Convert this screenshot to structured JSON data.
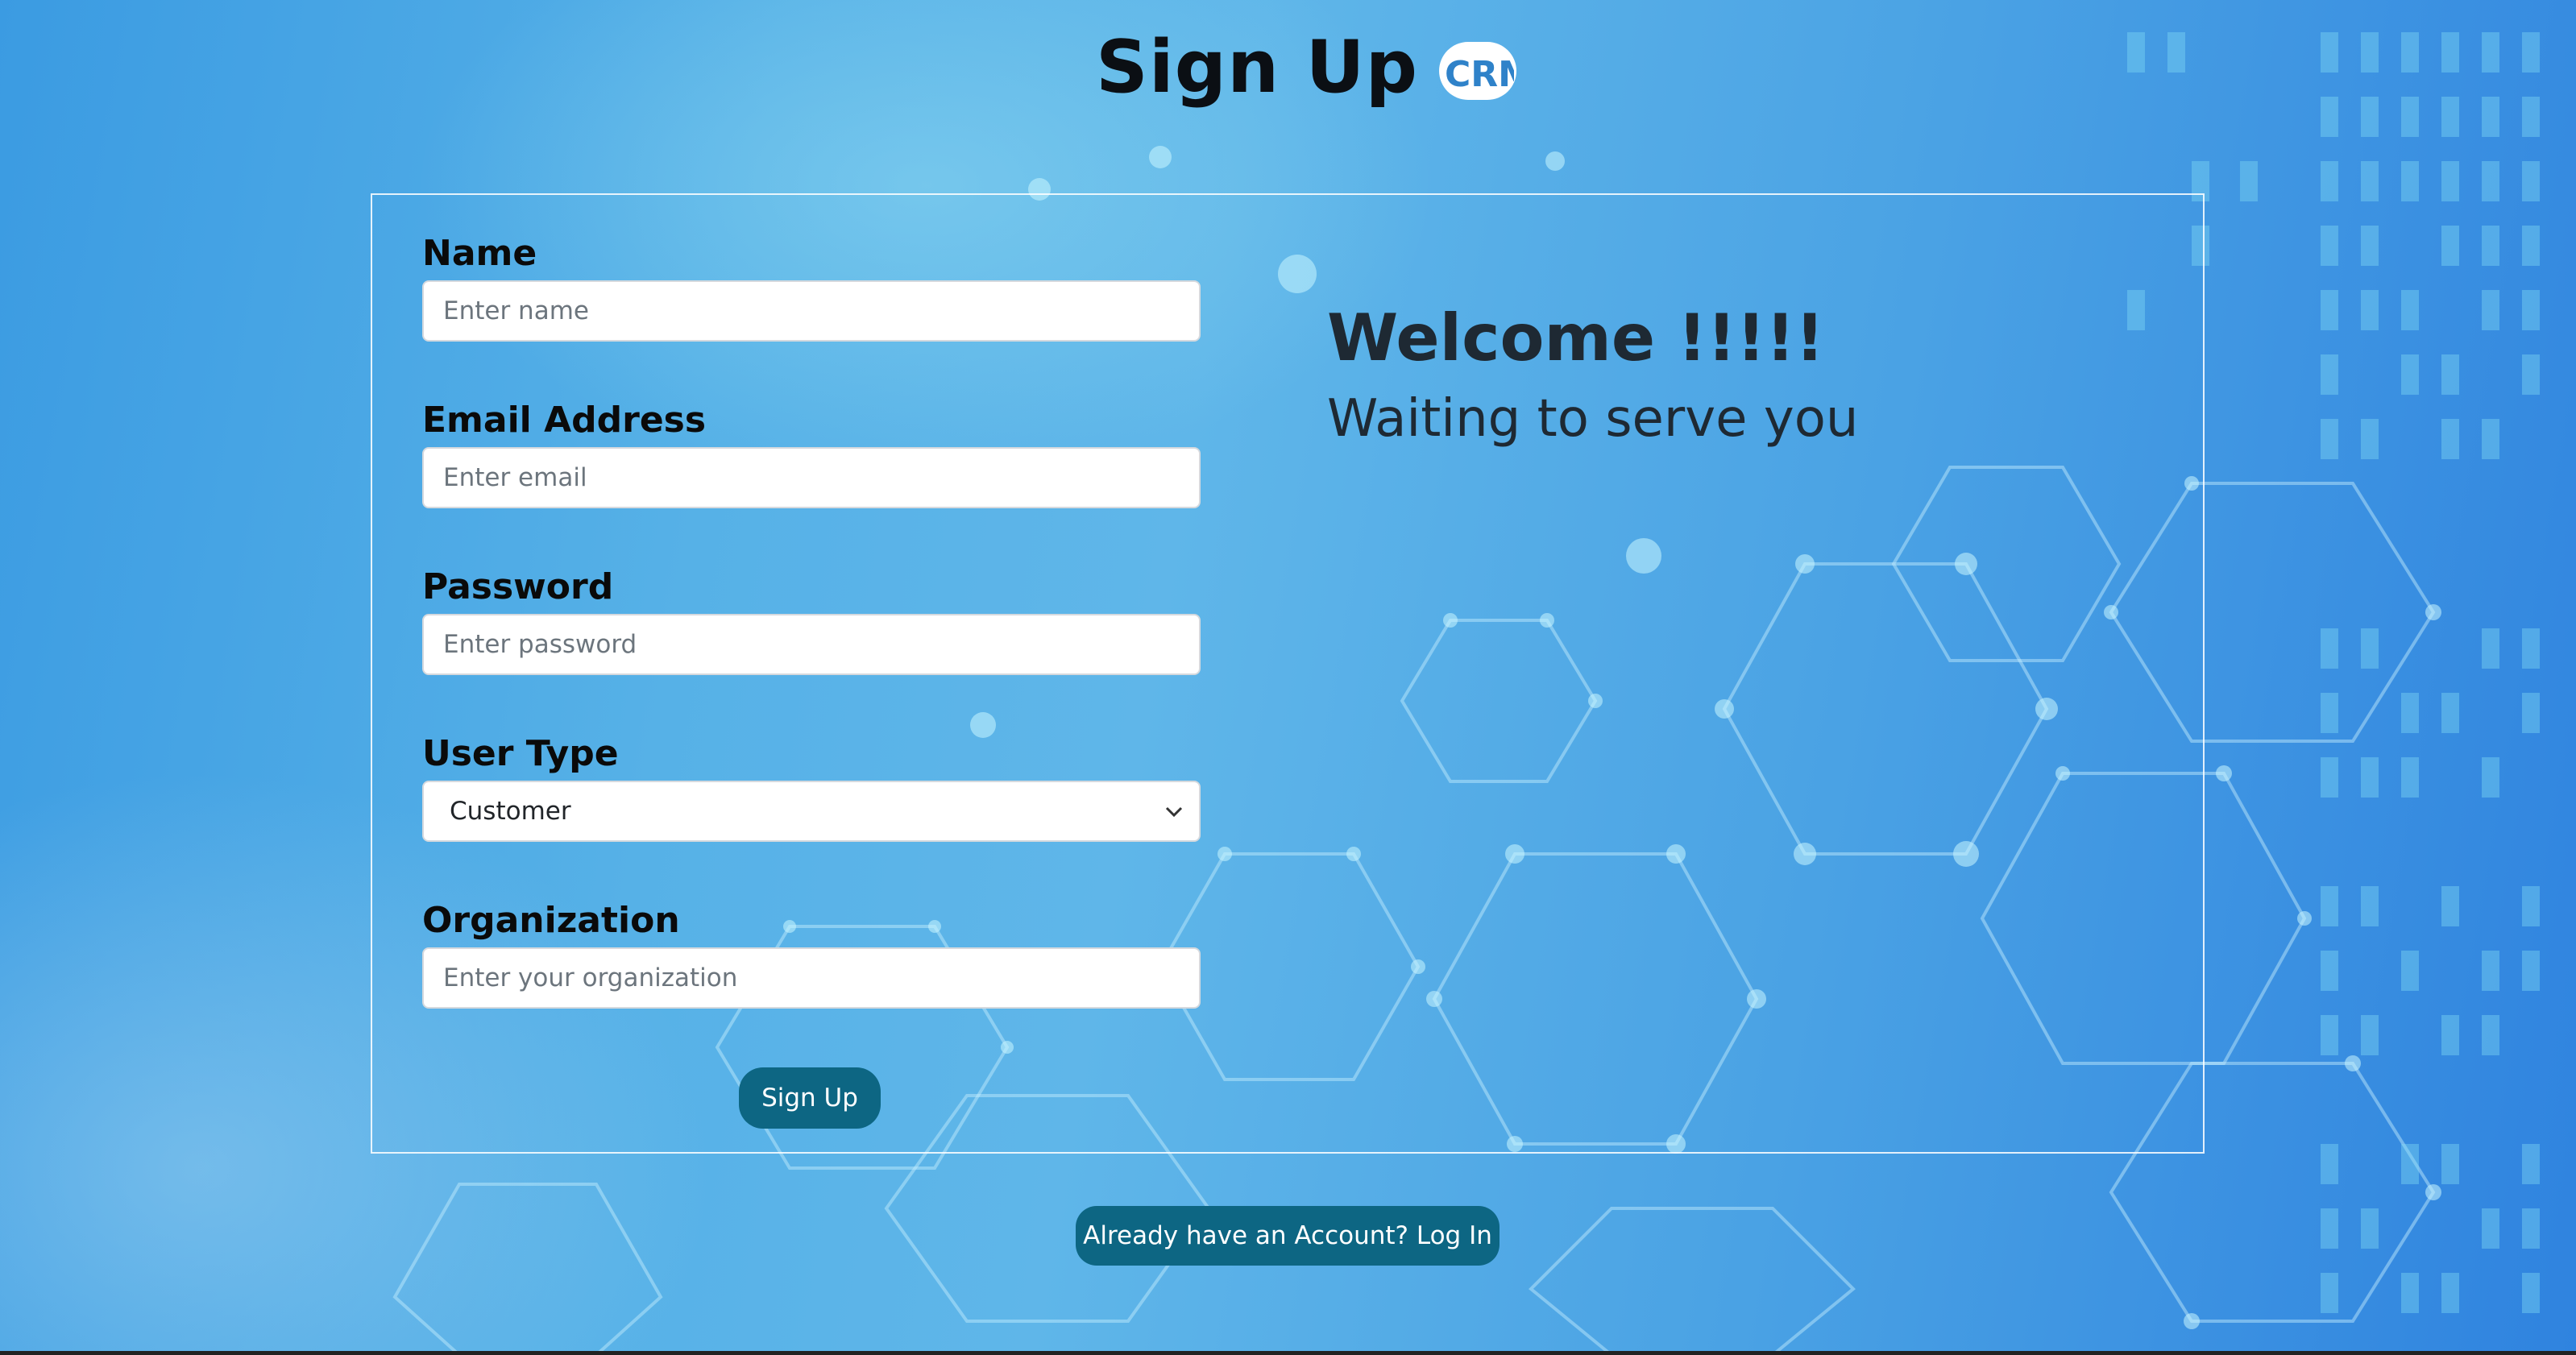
{
  "page": {
    "title": "Sign Up",
    "logo_text": "CRM",
    "colors": {
      "primary_button": "#0d6683",
      "text_dark": "#0b0f14",
      "card_border": "#ffffff"
    }
  },
  "form": {
    "name": {
      "label": "Name",
      "placeholder": "Enter name"
    },
    "email": {
      "label": "Email Address",
      "placeholder": "Enter email"
    },
    "password": {
      "label": "Password",
      "placeholder": "Enter password"
    },
    "user_type": {
      "label": "User Type",
      "selected": "Customer",
      "icon": "chevron-down-icon"
    },
    "organization": {
      "label": "Organization",
      "placeholder": "Enter your organization"
    },
    "submit_label": "Sign Up"
  },
  "welcome": {
    "heading": "Welcome !!!!!",
    "subheading": "Waiting to serve you"
  },
  "login_link_label": "Already have an Account? Log In"
}
